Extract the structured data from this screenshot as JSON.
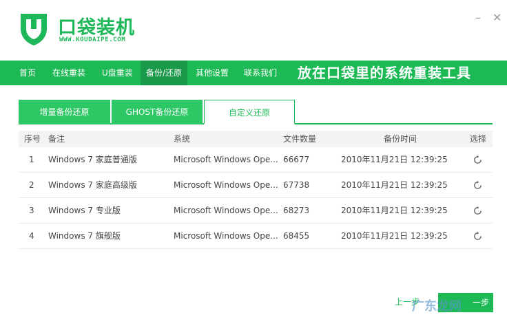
{
  "header": {
    "brand": "口袋装机",
    "url": "WWW.KOUDAIPE.COM",
    "min_glyph": "–",
    "close_glyph": "✕",
    "icons": [
      "logo-shield-icon",
      "minimize-icon",
      "close-icon"
    ]
  },
  "nav": {
    "items": [
      "首页",
      "在线重装",
      "U盘重装",
      "备份/还原",
      "其他设置",
      "联系我们"
    ],
    "active": "备份/还原",
    "slogan": "放在口袋里的系统重装工具"
  },
  "tabs": [
    "增量备份还原",
    "GHOST备份还原",
    "自定义还原"
  ],
  "table": {
    "headers": [
      "序号",
      "备注",
      "系统",
      "文件数量",
      "备份时间",
      "选择"
    ],
    "rows": [
      {
        "no": "1",
        "note": "Windows 7 家庭普通版",
        "system": "Microsoft Windows Ope...",
        "count": "66677",
        "time": "2010年11月21日 12:39:25"
      },
      {
        "no": "2",
        "note": "Windows 7 家庭高级版",
        "system": "Microsoft Windows Ope...",
        "count": "67738",
        "time": "2010年11月21日 12:39:25"
      },
      {
        "no": "3",
        "note": "Windows 7 专业版",
        "system": "Microsoft Windows Ope...",
        "count": "68273",
        "time": "2010年11月21日 12:39:25"
      },
      {
        "no": "4",
        "note": "Windows 7 旗舰版",
        "system": "Microsoft Windows Ope...",
        "count": "68455",
        "time": "2010年11月21日 12:39:25"
      }
    ]
  },
  "footer": {
    "prev": "上一步",
    "next": "一步",
    "watermark": "广东龙网"
  },
  "colors": {
    "accent": "#1db954",
    "nav_active": "#199a4a"
  }
}
